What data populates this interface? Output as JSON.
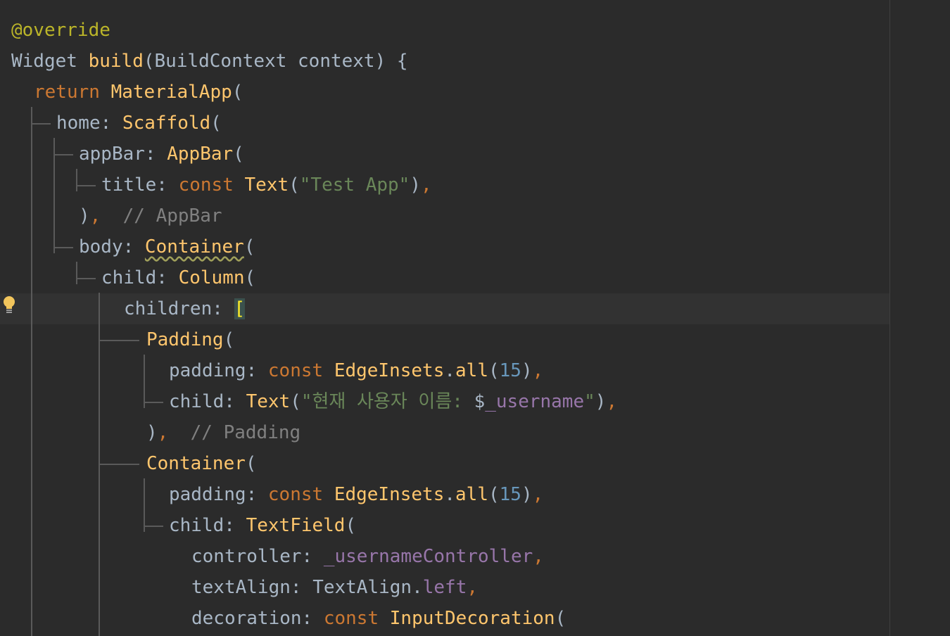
{
  "editor": {
    "language": "dart",
    "colors": {
      "background": "#2b2b2b",
      "current_line": "#323232",
      "plain": "#a9b7c6",
      "annotation": "#bbb529",
      "keyword": "#cc7832",
      "function": "#ffc66d",
      "string": "#6a8759",
      "number": "#6897bb",
      "field": "#9876aa",
      "comment": "#808080"
    },
    "intention_icon": "lightbulb-icon",
    "lines": [
      {
        "tokens": [
          {
            "t": "@override",
            "c": "ann"
          }
        ]
      },
      {
        "tokens": [
          {
            "t": "Widget ",
            "c": "plain"
          },
          {
            "t": "build",
            "c": "fn"
          },
          {
            "t": "(BuildContext context) {",
            "c": "plain"
          }
        ]
      },
      {
        "tokens": [
          {
            "t": "return ",
            "c": "kw"
          },
          {
            "t": "MaterialApp",
            "c": "fn"
          },
          {
            "t": "(",
            "c": "plain"
          }
        ]
      },
      {
        "tokens": [
          {
            "t": "home: ",
            "c": "plain"
          },
          {
            "t": "Scaffold",
            "c": "fn"
          },
          {
            "t": "(",
            "c": "plain"
          }
        ]
      },
      {
        "tokens": [
          {
            "t": "appBar: ",
            "c": "plain"
          },
          {
            "t": "AppBar",
            "c": "fn"
          },
          {
            "t": "(",
            "c": "plain"
          }
        ]
      },
      {
        "tokens": [
          {
            "t": "title: ",
            "c": "plain"
          },
          {
            "t": "const ",
            "c": "kw"
          },
          {
            "t": "Text",
            "c": "fn"
          },
          {
            "t": "(",
            "c": "plain"
          },
          {
            "t": "\"Test App\"",
            "c": "str"
          },
          {
            "t": ")",
            "c": "plain"
          },
          {
            "t": ",",
            "c": "kw"
          }
        ]
      },
      {
        "tokens": [
          {
            "t": ")",
            "c": "plain"
          },
          {
            "t": ",  ",
            "c": "kw"
          },
          {
            "t": "// AppBar",
            "c": "comment"
          }
        ]
      },
      {
        "tokens": [
          {
            "t": "body: ",
            "c": "plain"
          },
          {
            "t": "Container",
            "c": "fn",
            "warn": true
          },
          {
            "t": "(",
            "c": "plain"
          }
        ]
      },
      {
        "tokens": [
          {
            "t": "child: ",
            "c": "plain"
          },
          {
            "t": "Column",
            "c": "fn"
          },
          {
            "t": "(",
            "c": "plain"
          }
        ]
      },
      {
        "tokens": [
          {
            "t": "children: ",
            "c": "plain"
          },
          {
            "t": "[",
            "c": "bracket-hl"
          }
        ],
        "current": true
      },
      {
        "tokens": [
          {
            "t": "Padding",
            "c": "fn"
          },
          {
            "t": "(",
            "c": "plain"
          }
        ]
      },
      {
        "tokens": [
          {
            "t": "padding: ",
            "c": "plain"
          },
          {
            "t": "const ",
            "c": "kw"
          },
          {
            "t": "EdgeInsets",
            "c": "fn"
          },
          {
            "t": ".",
            "c": "plain"
          },
          {
            "t": "all",
            "c": "fn"
          },
          {
            "t": "(",
            "c": "plain"
          },
          {
            "t": "15",
            "c": "num"
          },
          {
            "t": ")",
            "c": "plain"
          },
          {
            "t": ",",
            "c": "kw"
          }
        ]
      },
      {
        "tokens": [
          {
            "t": "child: ",
            "c": "plain"
          },
          {
            "t": "Text",
            "c": "fn"
          },
          {
            "t": "(",
            "c": "plain"
          },
          {
            "t": "\"현재 사용자 이름: ",
            "c": "str"
          },
          {
            "t": "$",
            "c": "plain"
          },
          {
            "t": "_username",
            "c": "field"
          },
          {
            "t": "\"",
            "c": "str"
          },
          {
            "t": ")",
            "c": "plain"
          },
          {
            "t": ",",
            "c": "kw"
          }
        ]
      },
      {
        "tokens": [
          {
            "t": ")",
            "c": "plain"
          },
          {
            "t": ",  ",
            "c": "kw"
          },
          {
            "t": "// Padding",
            "c": "comment"
          }
        ]
      },
      {
        "tokens": [
          {
            "t": "Container",
            "c": "fn"
          },
          {
            "t": "(",
            "c": "plain"
          }
        ]
      },
      {
        "tokens": [
          {
            "t": "padding: ",
            "c": "plain"
          },
          {
            "t": "const ",
            "c": "kw"
          },
          {
            "t": "EdgeInsets",
            "c": "fn"
          },
          {
            "t": ".",
            "c": "plain"
          },
          {
            "t": "all",
            "c": "fn"
          },
          {
            "t": "(",
            "c": "plain"
          },
          {
            "t": "15",
            "c": "num"
          },
          {
            "t": ")",
            "c": "plain"
          },
          {
            "t": ",",
            "c": "kw"
          }
        ]
      },
      {
        "tokens": [
          {
            "t": "child: ",
            "c": "plain"
          },
          {
            "t": "TextField",
            "c": "fn"
          },
          {
            "t": "(",
            "c": "plain"
          }
        ]
      },
      {
        "tokens": [
          {
            "t": "controller: ",
            "c": "plain"
          },
          {
            "t": "_usernameController",
            "c": "field"
          },
          {
            "t": ",",
            "c": "kw"
          }
        ]
      },
      {
        "tokens": [
          {
            "t": "textAlign: ",
            "c": "plain"
          },
          {
            "t": "TextAlign.",
            "c": "plain"
          },
          {
            "t": "left",
            "c": "field"
          },
          {
            "t": ",",
            "c": "kw"
          }
        ]
      },
      {
        "tokens": [
          {
            "t": "decoration: ",
            "c": "plain"
          },
          {
            "t": "const ",
            "c": "kw"
          },
          {
            "t": "InputDecoration",
            "c": "fn"
          },
          {
            "t": "(",
            "c": "plain"
          }
        ]
      }
    ]
  }
}
